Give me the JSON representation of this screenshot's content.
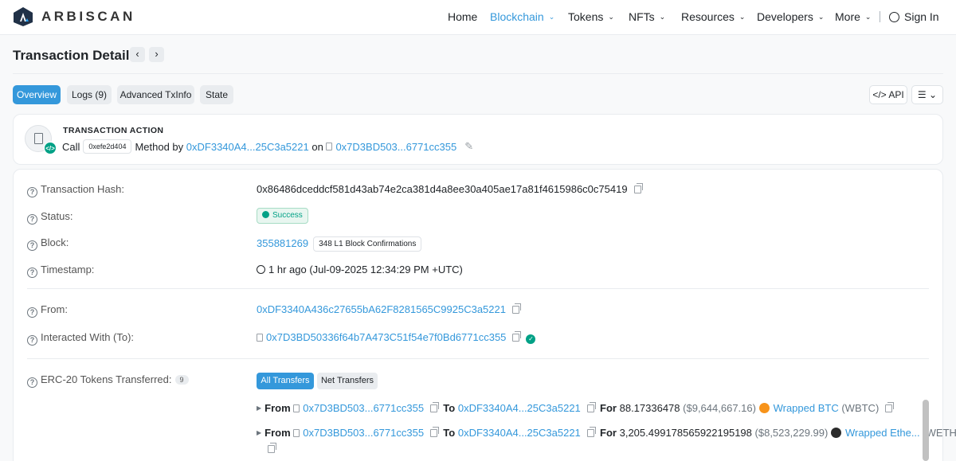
{
  "header": {
    "brand": "ARBISCAN",
    "nav": [
      {
        "label": "Home",
        "dropdown": false
      },
      {
        "label": "Blockchain",
        "dropdown": true
      },
      {
        "label": "Tokens",
        "dropdown": true
      },
      {
        "label": "NFTs",
        "dropdown": true
      },
      {
        "label": "Resources",
        "dropdown": true
      },
      {
        "label": "Developers",
        "dropdown": true
      },
      {
        "label": "More",
        "dropdown": true
      }
    ],
    "sign_in": "Sign In"
  },
  "page": {
    "title": "Transaction Details"
  },
  "tabs": [
    "Overview",
    "Logs (9)",
    "Advanced TxInfo",
    "State"
  ],
  "toolbar": {
    "api": "API"
  },
  "action": {
    "title": "TRANSACTION ACTION",
    "call": "Call",
    "method_id": "0xefe2d404",
    "method_by": "Method by",
    "from_short": "0xDF3340A4...25C3a5221",
    "on": "on",
    "contract_short": "0x7D3BD503...6771cc355"
  },
  "details": {
    "hash_label": "Transaction Hash:",
    "hash": "0x86486dceddcf581d43ab74e2ca381d4a8ee30a405ae17a81f4615986c0c75419",
    "status_label": "Status:",
    "status": "Success",
    "block_label": "Block:",
    "block": "355881269",
    "confirmations": "348 L1 Block Confirmations",
    "timestamp_label": "Timestamp:",
    "timestamp": "1 hr ago (Jul-09-2025 12:34:29 PM +UTC)",
    "from_label": "From:",
    "from": "0xDF3340A436c27655bA62F8281565C9925C3a5221",
    "to_label": "Interacted With (To):",
    "to": "0x7D3BD50336f64b7A473C51f54e7f0Bd6771cc355",
    "erc20_label": "ERC-20 Tokens Transferred:",
    "erc20_count": "9",
    "filter_all": "All Transfers",
    "filter_net": "Net Transfers"
  },
  "transfers": [
    {
      "from_word": "From",
      "from": "0x7D3BD503...6771cc355",
      "to_word": "To",
      "to": "0xDF3340A4...25C3a5221",
      "for_word": "For",
      "amount": "88.17336478",
      "usd": "($9,644,667.16)",
      "token": "Wrapped BTC",
      "symbol": "(WBTC)",
      "icon_color": "#f7931a"
    },
    {
      "from_word": "From",
      "from": "0x7D3BD503...6771cc355",
      "to_word": "To",
      "to": "0xDF3340A4...25C3a5221",
      "for_word": "For",
      "amount": "3,205.499178565922195198",
      "usd": "($8,523,229.99)",
      "token": "Wrapped Ethe...",
      "symbol": "(WETH)",
      "icon_color": "#2b2b2b"
    }
  ],
  "colors": {
    "accent": "#3498db",
    "success": "#00a186"
  }
}
